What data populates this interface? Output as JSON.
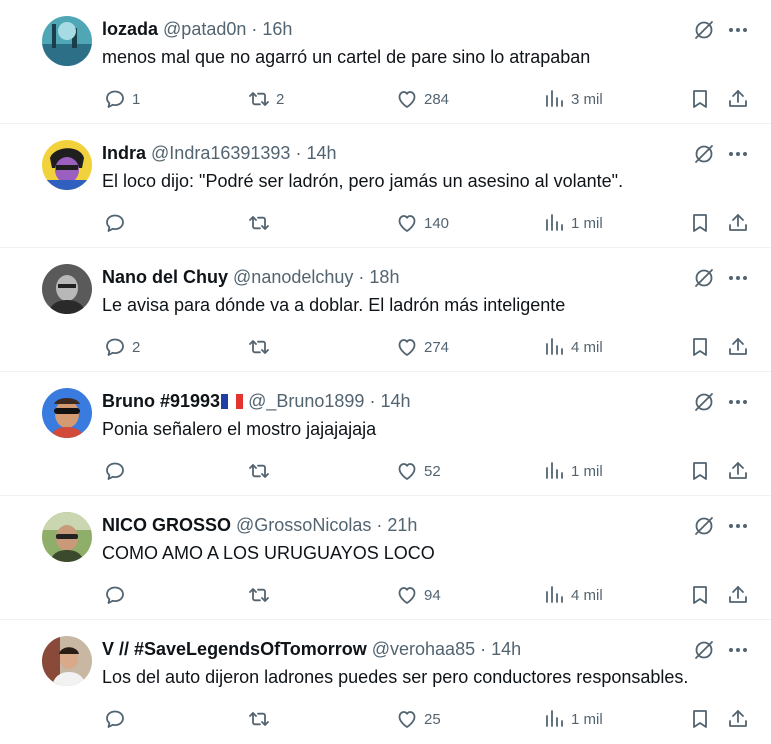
{
  "icons": {
    "reply": "reply-icon",
    "retweet": "retweet-icon",
    "like": "heart-icon",
    "views": "views-chart-icon",
    "bookmark": "bookmark-icon",
    "share": "share-icon",
    "grok": "grok-icon",
    "more": "more-icon"
  },
  "colors": {
    "secondary_text": "#536471",
    "primary_text": "#0f1419"
  },
  "tweets": [
    {
      "name": "lozada",
      "handle": "@patad0n",
      "sep": "·",
      "time": "16h",
      "text": "menos mal que no agarró un cartel de pare sino lo atrapaban",
      "replies": "1",
      "retweets": "2",
      "likes": "284",
      "views": "3 mil"
    },
    {
      "name": "Indra",
      "handle": "@Indra16391393",
      "sep": "·",
      "time": "14h",
      "text": "El loco dijo: \"Podré ser ladrón, pero jamás un asesino al volante\".",
      "replies": "",
      "retweets": "",
      "likes": "140",
      "views": "1 mil"
    },
    {
      "name": "Nano del Chuy",
      "handle": "@nanodelchuy",
      "sep": "·",
      "time": "18h",
      "text": "Le avisa para dónde va a doblar. El ladrón más inteligente",
      "replies": "2",
      "retweets": "",
      "likes": "274",
      "views": "4 mil"
    },
    {
      "name": "Bruno #91993",
      "handle": "@_Bruno1899",
      "sep": "·",
      "time": "14h",
      "text": "Ponia señalero el mostro jajajajaja",
      "replies": "",
      "retweets": "",
      "likes": "52",
      "views": "1 mil",
      "flag": "france-flag"
    },
    {
      "name": "NICO GROSSO",
      "handle": "@GrossoNicolas",
      "sep": "·",
      "time": "21h",
      "text": "COMO AMO A LOS URUGUAYOS LOCO",
      "replies": "",
      "retweets": "",
      "likes": "94",
      "views": "4 mil"
    },
    {
      "name": "V // #SaveLegendsOfTomorrow",
      "handle": "@verohaa85",
      "sep": "·",
      "time": "14h",
      "text": "Los del auto dijeron ladrones puedes ser pero conductores responsables.",
      "replies": "",
      "retweets": "",
      "likes": "25",
      "views": "1 mil"
    }
  ]
}
